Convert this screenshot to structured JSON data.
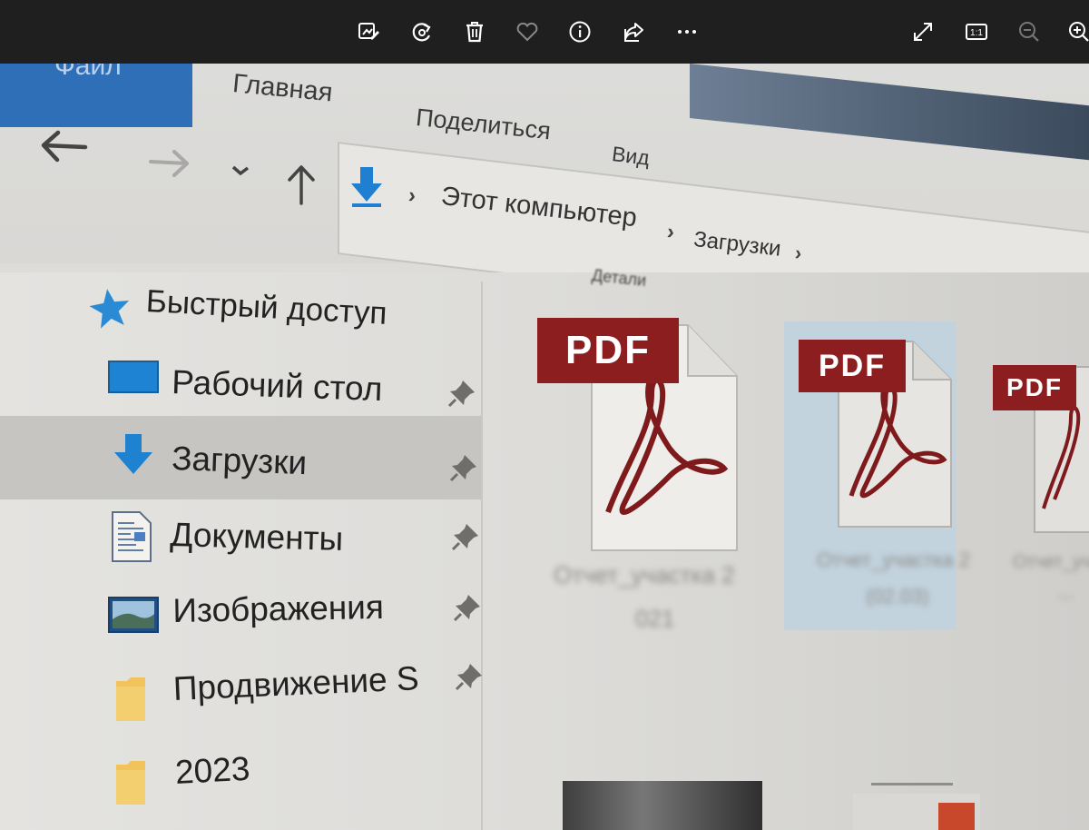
{
  "viewer_toolbar": {
    "buttons": [
      {
        "name": "edit-icon"
      },
      {
        "name": "rotate-icon"
      },
      {
        "name": "delete-icon"
      },
      {
        "name": "favorite-icon"
      },
      {
        "name": "info-icon"
      },
      {
        "name": "share-icon"
      },
      {
        "name": "more-icon",
        "label": "···"
      },
      {
        "name": "fullscreen-icon"
      },
      {
        "name": "actual-size-icon",
        "label": "1:1"
      },
      {
        "name": "zoom-out-icon"
      },
      {
        "name": "zoom-in-icon"
      }
    ]
  },
  "explorer": {
    "ribbon_tabs": {
      "file": "Файл",
      "home": "Главная",
      "share": "Поделиться",
      "view": "Вид"
    },
    "breadcrumb": {
      "this_pc": "Этот компьютер",
      "downloads": "Загрузки"
    },
    "sidebar": {
      "quick_access": "Быстрый доступ",
      "items": [
        {
          "label": "Рабочий стол",
          "pinned": true
        },
        {
          "label": "Загрузки",
          "pinned": true,
          "selected": true
        },
        {
          "label": "Документы",
          "pinned": true
        },
        {
          "label": "Изображения",
          "pinned": true
        },
        {
          "label": "Продвижение S",
          "pinned": true
        },
        {
          "label": "2023",
          "pinned": false
        }
      ]
    },
    "files": {
      "pdf_badge": "PDF",
      "tiles": [
        {
          "name_line1": "Отчет_участка 2",
          "name_line2": "021"
        },
        {
          "name_line1": "Отчет_участка 2",
          "name_line2": "(02.03)",
          "selected": true
        },
        {
          "name_line1": "Отчет_уча",
          "name_line2": "..."
        }
      ],
      "group_header": "Детали"
    }
  },
  "colors": {
    "pdf_red": "#8d1e1f",
    "accent_blue": "#2e8bd6",
    "selection": "#c6c5c2"
  }
}
